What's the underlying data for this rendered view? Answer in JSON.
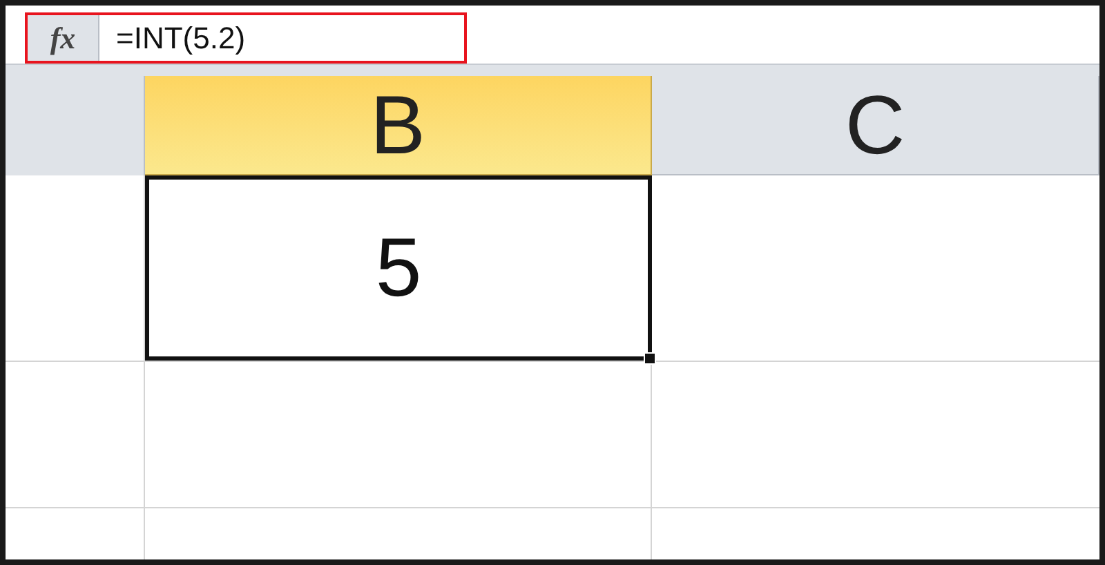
{
  "formula_bar": {
    "function_button": "fx",
    "formula": "=INT(5.2)",
    "highlighted": true
  },
  "columns": [
    {
      "label": "B",
      "selected": true
    },
    {
      "label": "C",
      "selected": false
    }
  ],
  "selected_cell": {
    "value": "5"
  }
}
